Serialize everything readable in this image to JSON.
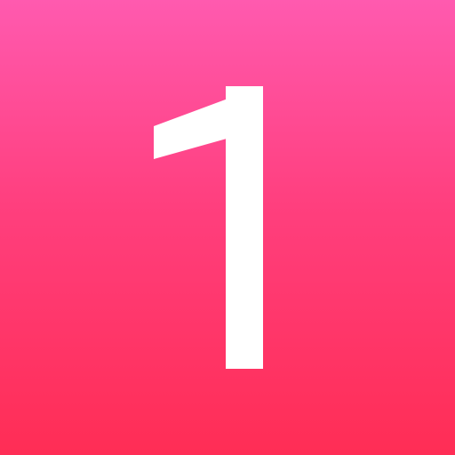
{
  "icon": {
    "numeral": "1",
    "icon_name": "number-one-icon",
    "colors": {
      "gradient_top": "#FF5AAF",
      "gradient_mid": "#FF3F7E",
      "gradient_bottom": "#FF2D55",
      "glyph": "#FFFFFF"
    }
  }
}
